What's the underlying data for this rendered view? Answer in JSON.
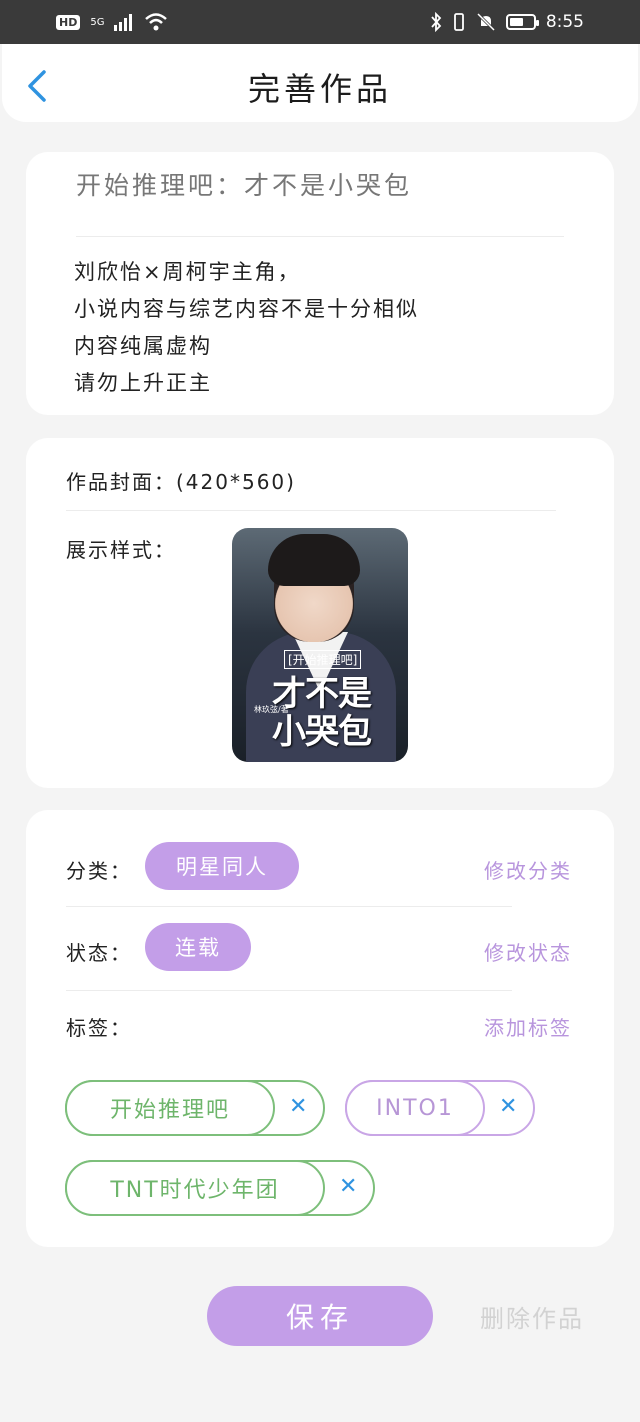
{
  "status_bar": {
    "hd": "HD",
    "signal": "5G",
    "time": "8:55",
    "battery_level": 0.6
  },
  "header": {
    "title": "完善作品"
  },
  "work": {
    "title": "开始推理吧：才不是小哭包",
    "description": [
      "刘欣怡×周柯宇主角，",
      "小说内容与综艺内容不是十分相似",
      "内容纯属虚构",
      "请勿上升正主"
    ]
  },
  "cover": {
    "label": "作品封面：(420*560)",
    "display_label": "展示样式：",
    "image_text": {
      "series": "[开始推理吧]",
      "line1": "才不是",
      "line2": "小哭包",
      "author": "林玖弦/著"
    }
  },
  "meta": {
    "category_label": "分类：",
    "category_value": "明星同人",
    "category_edit": "修改分类",
    "status_label": "状态：",
    "status_value": "连载",
    "status_edit": "修改状态",
    "tags_label": "标签：",
    "tags_add": "添加标签",
    "tags": [
      {
        "name": "开始推理吧",
        "color": "#7dbf7b"
      },
      {
        "name": "INTO1",
        "color": "#c9a6e6"
      },
      {
        "name": "TNT时代少年团",
        "color": "#7dbf7b"
      }
    ],
    "remove_symbol": "✕"
  },
  "actions": {
    "save": "保存",
    "delete": "删除作品"
  },
  "colors": {
    "accent": "#c39ee8",
    "link": "#b895dd",
    "remove": "#2f93e0",
    "back": "#2f93e0"
  }
}
